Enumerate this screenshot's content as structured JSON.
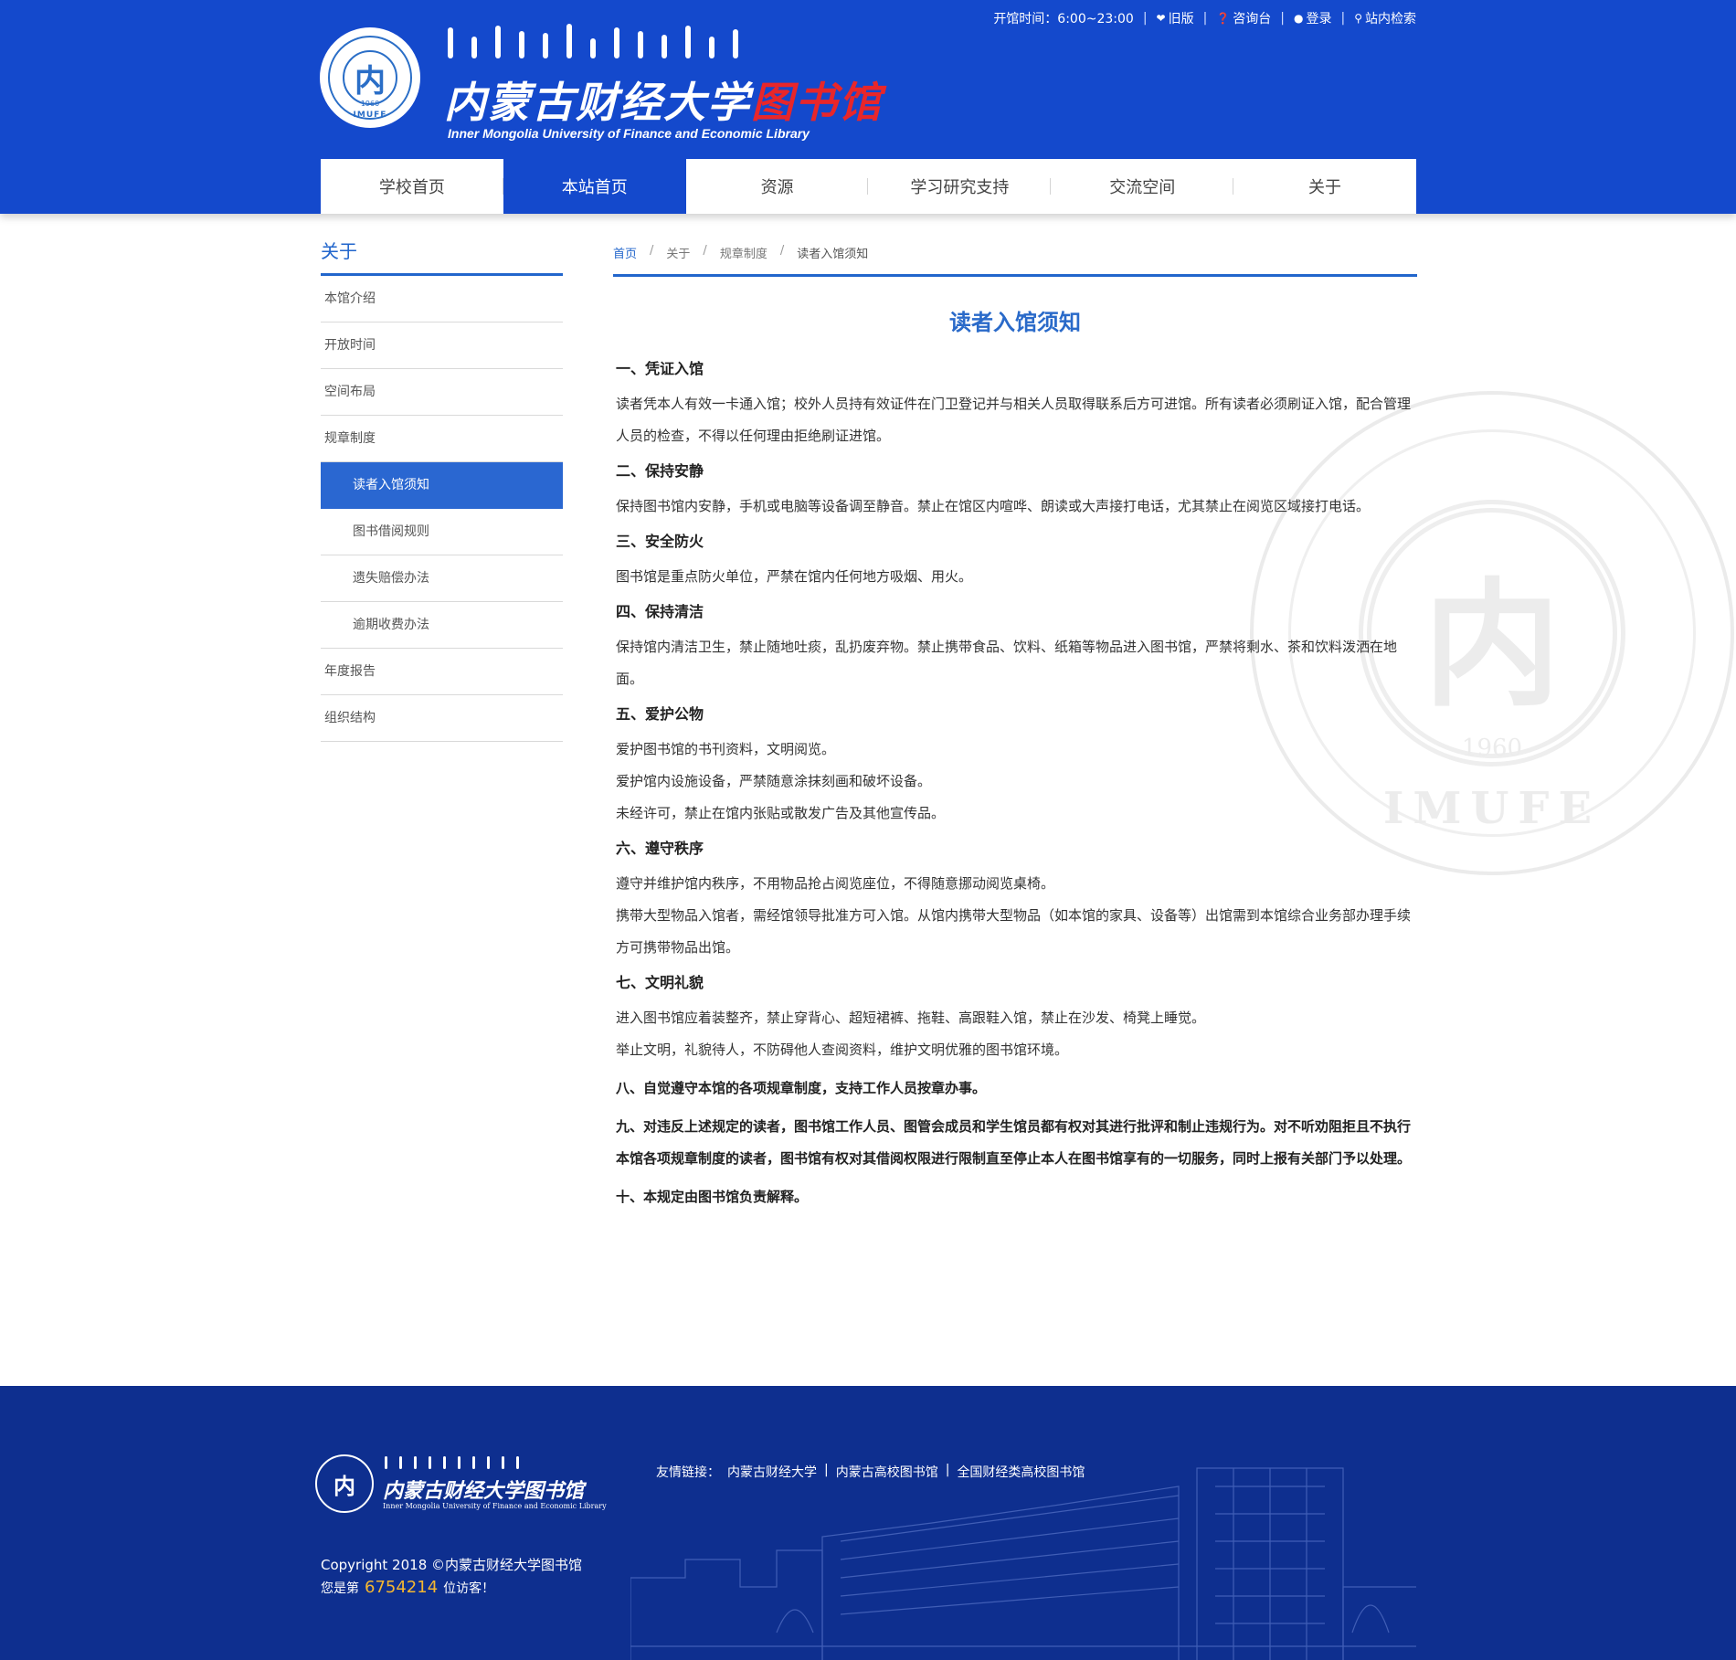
{
  "header": {
    "logo_title_black": "内蒙古财经大学",
    "logo_title_red": "图书馆",
    "logo_subtitle": "Inner Mongolia University of Finance and Economic Library",
    "seal_char": "内",
    "seal_year": "1960",
    "seal_abbr": "IMUFE",
    "opening_hours": "开馆时间：6:00~23:00",
    "links": [
      {
        "label": "旧版",
        "icon": "heart-icon"
      },
      {
        "label": "咨询台",
        "icon": "question-icon"
      },
      {
        "label": "登录",
        "icon": "user-icon"
      },
      {
        "label": "站内检索",
        "icon": "search-icon"
      }
    ]
  },
  "nav": {
    "items": [
      "学校首页",
      "本站首页",
      "资源",
      "学习研究支持",
      "交流空间",
      "关于"
    ],
    "active_index": 1
  },
  "sidebar": {
    "title": "关于",
    "items": [
      {
        "label": "本馆介绍"
      },
      {
        "label": "开放时间"
      },
      {
        "label": "空间布局"
      },
      {
        "label": "规章制度"
      },
      {
        "label": "读者入馆须知"
      },
      {
        "label": "图书借阅规则"
      },
      {
        "label": "遗失赔偿办法"
      },
      {
        "label": "逾期收费办法"
      },
      {
        "label": "年度报告"
      },
      {
        "label": "组织结构"
      }
    ]
  },
  "breadcrumb": {
    "items": [
      "首页",
      "关于",
      "规章制度"
    ],
    "current": "读者入馆须知"
  },
  "article": {
    "title": "读者入馆须知",
    "sections": [
      {
        "heading": "一、凭证入馆",
        "paras": [
          "读者凭本人有效一卡通入馆；校外人员持有效证件在门卫登记并与相关人员取得联系后方可进馆。所有读者必须刷证入馆，配合管理人员的检查，不得以任何理由拒绝刷证进馆。"
        ]
      },
      {
        "heading": "二、保持安静",
        "paras": [
          "保持图书馆内安静，手机或电脑等设备调至静音。禁止在馆区内喧哗、朗读或大声接打电话，尤其禁止在阅览区域接打电话。"
        ]
      },
      {
        "heading": "三、安全防火",
        "paras": [
          "图书馆是重点防火单位，严禁在馆内任何地方吸烟、用火。"
        ]
      },
      {
        "heading": "四、保持清洁",
        "paras": [
          "保持馆内清洁卫生，禁止随地吐痰，乱扔废弃物。禁止携带食品、饮料、纸箱等物品进入图书馆，严禁将剩水、茶和饮料泼洒在地面。"
        ]
      },
      {
        "heading": "五、爱护公物",
        "paras": [
          "爱护图书馆的书刊资料，文明阅览。",
          "爱护馆内设施设备，严禁随意涂抹刻画和破坏设备。",
          "未经许可，禁止在馆内张贴或散发广告及其他宣传品。"
        ]
      },
      {
        "heading": "六、遵守秩序",
        "paras": [
          "遵守并维护馆内秩序，不用物品抢占阅览座位，不得随意挪动阅览桌椅。",
          "携带大型物品入馆者，需经馆领导批准方可入馆。从馆内携带大型物品（如本馆的家具、设备等）出馆需到本馆综合业务部办理手续方可携带物品出馆。"
        ]
      },
      {
        "heading": "七、文明礼貌",
        "paras": [
          "进入图书馆应着装整齐，禁止穿背心、超短裙裤、拖鞋、高跟鞋入馆，禁止在沙发、椅凳上睡觉。",
          "举止文明，礼貌待人，不防碍他人查阅资料，维护文明优雅的图书馆环境。"
        ]
      }
    ],
    "closing": [
      "八、自觉遵守本馆的各项规章制度，支持工作人员按章办事。",
      "九、对违反上述规定的读者，图书馆工作人员、图管会成员和学生馆员都有权对其进行批评和制止违规行为。对不听劝阻拒且不执行本馆各项规章制度的读者，图书馆有权对其借阅权限进行限制直至停止本人在图书馆享有的一切服务，同时上报有关部门予以处理。",
      "十、本规定由图书馆负责解释。"
    ]
  },
  "footer": {
    "links_prefix": "友情链接：",
    "links": [
      "内蒙古财经大学",
      "内蒙古高校图书馆",
      "全国财经类高校图书馆"
    ],
    "copyright": "Copyright 2018 ©内蒙古财经大学图书馆",
    "visitor_prefix": "您是第",
    "visitor_count": "6754214",
    "visitor_suffix": "位访客！",
    "logo_title": "内蒙古财经大学图书馆",
    "logo_subtitle": "Inner Mongolia University of Finance and Economic Library"
  },
  "colors": {
    "brand_blue": "#1449cc",
    "accent_blue": "#2266cc",
    "footer_blue": "#0e2f8f",
    "logo_red": "#e8262a",
    "visitor_orange": "#f5b731"
  }
}
